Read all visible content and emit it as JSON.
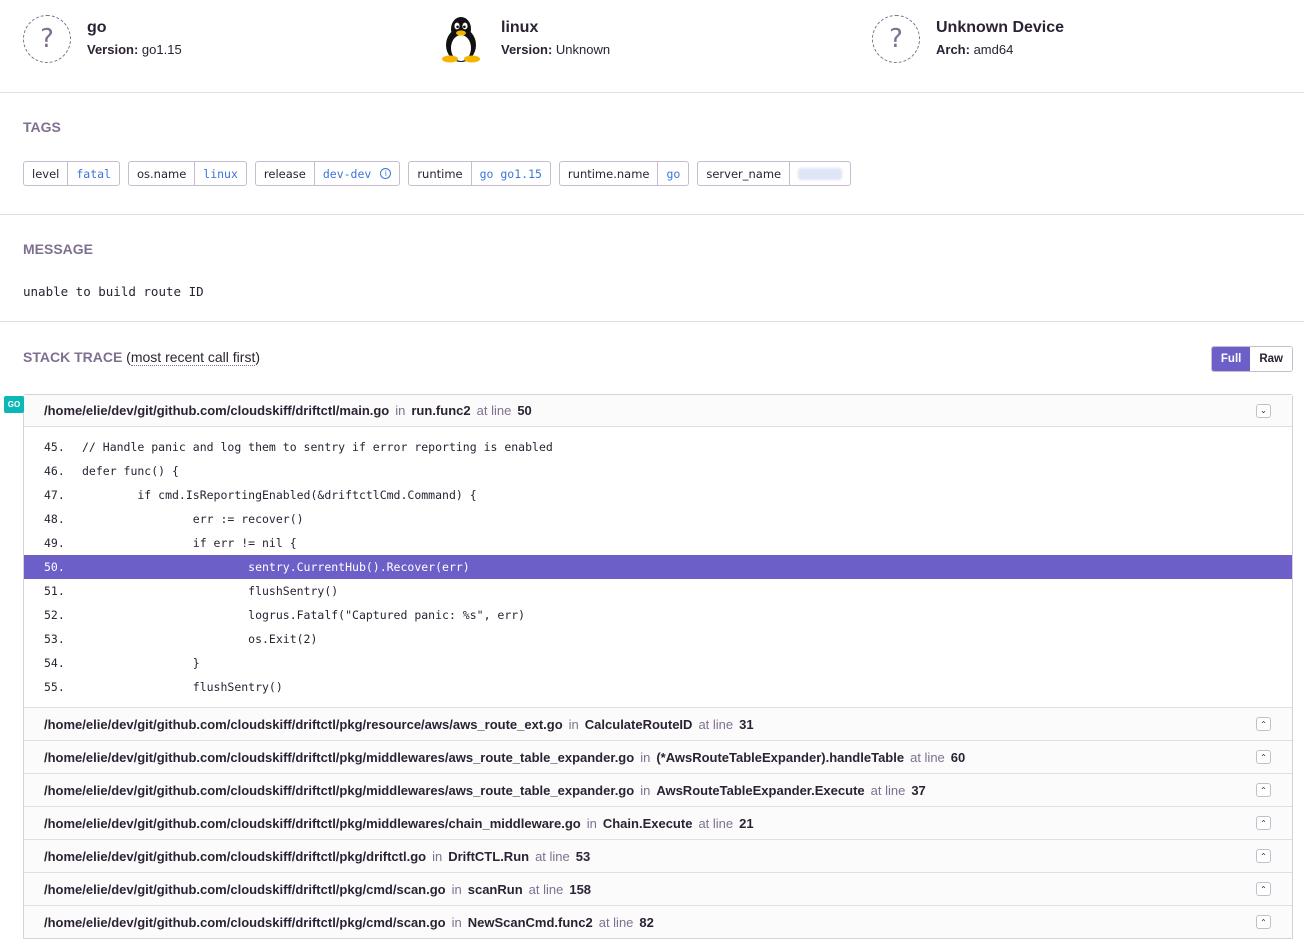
{
  "context": [
    {
      "title": "go",
      "sub_label": "Version:",
      "sub_value": "go1.15",
      "icon": "unknown-icon"
    },
    {
      "title": "linux",
      "sub_label": "Version:",
      "sub_value": "Unknown",
      "icon": "linux-icon"
    },
    {
      "title": "Unknown Device",
      "sub_label": "Arch:",
      "sub_value": "amd64",
      "icon": "unknown-icon"
    }
  ],
  "tags": {
    "heading": "TAGS",
    "items": [
      {
        "key": "level",
        "value": "fatal"
      },
      {
        "key": "os.name",
        "value": "linux"
      },
      {
        "key": "release",
        "value": "dev-dev"
      },
      {
        "key": "runtime",
        "value": "go go1.15"
      },
      {
        "key": "runtime.name",
        "value": "go"
      },
      {
        "key": "server_name",
        "value": ""
      }
    ]
  },
  "message": {
    "heading": "MESSAGE",
    "text": "unable to build route ID"
  },
  "stack": {
    "heading": "STACK TRACE",
    "subheading": "most recent call first",
    "toggle_full": "Full",
    "toggle_raw": "Raw",
    "platform_badge": "GO",
    "in_label": "in",
    "at_line_label": "at line",
    "frames": [
      {
        "file": "/home/elie/dev/git/github.com/cloudskiff/driftctl/main.go",
        "function": "run.func2",
        "line": "50"
      },
      {
        "file": "/home/elie/dev/git/github.com/cloudskiff/driftctl/pkg/resource/aws/aws_route_ext.go",
        "function": "CalculateRouteID",
        "line": "31"
      },
      {
        "file": "/home/elie/dev/git/github.com/cloudskiff/driftctl/pkg/middlewares/aws_route_table_expander.go",
        "function": "(*AwsRouteTableExpander).handleTable",
        "line": "60"
      },
      {
        "file": "/home/elie/dev/git/github.com/cloudskiff/driftctl/pkg/middlewares/aws_route_table_expander.go",
        "function": "AwsRouteTableExpander.Execute",
        "line": "37"
      },
      {
        "file": "/home/elie/dev/git/github.com/cloudskiff/driftctl/pkg/middlewares/chain_middleware.go",
        "function": "Chain.Execute",
        "line": "21"
      },
      {
        "file": "/home/elie/dev/git/github.com/cloudskiff/driftctl/pkg/driftctl.go",
        "function": "DriftCTL.Run",
        "line": "53"
      },
      {
        "file": "/home/elie/dev/git/github.com/cloudskiff/driftctl/pkg/cmd/scan.go",
        "function": "scanRun",
        "line": "158"
      },
      {
        "file": "/home/elie/dev/git/github.com/cloudskiff/driftctl/pkg/cmd/scan.go",
        "function": "NewScanCmd.func2",
        "line": "82"
      }
    ],
    "code": [
      {
        "num": "45.",
        "text": "// Handle panic and log them to sentry if error reporting is enabled"
      },
      {
        "num": "46.",
        "text": "defer func() {"
      },
      {
        "num": "47.",
        "text": "        if cmd.IsReportingEnabled(&driftctlCmd.Command) {"
      },
      {
        "num": "48.",
        "text": "                err := recover()"
      },
      {
        "num": "49.",
        "text": "                if err != nil {"
      },
      {
        "num": "50.",
        "text": "                        sentry.CurrentHub().Recover(err)"
      },
      {
        "num": "51.",
        "text": "                        flushSentry()"
      },
      {
        "num": "52.",
        "text": "                        logrus.Fatalf(\"Captured panic: %s\", err)"
      },
      {
        "num": "53.",
        "text": "                        os.Exit(2)"
      },
      {
        "num": "54.",
        "text": "                }"
      },
      {
        "num": "55.",
        "text": "                flushSentry()"
      }
    ],
    "active_line": "50."
  }
}
